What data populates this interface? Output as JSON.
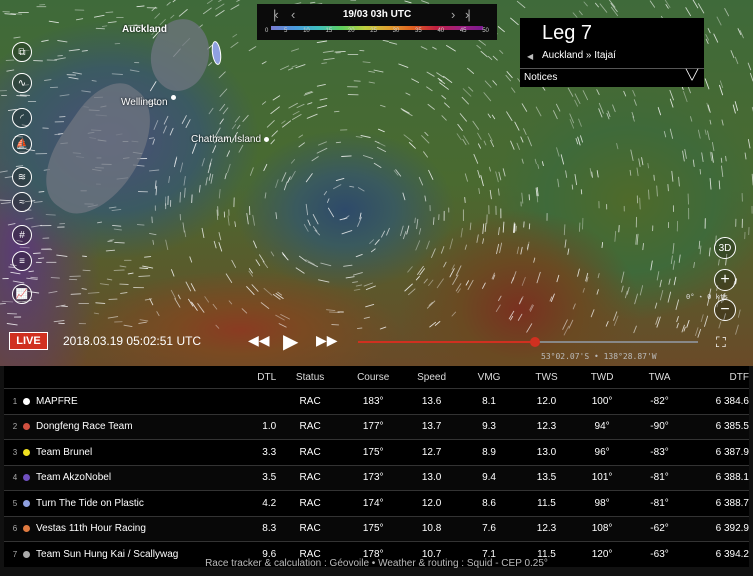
{
  "topbar": {
    "datetime": "19/03 03h UTC",
    "scale_ticks": [
      "0",
      "5",
      "10",
      "15",
      "20",
      "25",
      "30",
      "35",
      "40",
      "45",
      "50"
    ]
  },
  "map": {
    "places": [
      "Auckland",
      "Wellington",
      "Chatham Island"
    ]
  },
  "leg": {
    "title": "Leg 7",
    "route": "Auckland » Itajaí",
    "notices_label": "Notices"
  },
  "controls": {
    "view3d_label": "3D",
    "zoom_in": "+",
    "zoom_out": "−"
  },
  "compass": {
    "text": "0° ⋆ 0 kts"
  },
  "playback": {
    "live_label": "LIVE",
    "time": "2018.03.19 05:02:51 UTC",
    "progress": 0.52,
    "coordinates": "53°02.07'S • 138°28.87'W"
  },
  "table": {
    "headers": [
      "DTL",
      "Status",
      "Course",
      "Speed",
      "VMG",
      "TWS",
      "TWD",
      "TWA",
      "DTF"
    ],
    "rows": [
      {
        "rank": "1",
        "color": "#ffffff",
        "name": "MAPFRE",
        "dtl": "",
        "status": "RAC",
        "course": "183°",
        "speed": "13.6",
        "vmg": "8.1",
        "tws": "12.0",
        "twd": "100°",
        "twa": "-82°",
        "dtf": "6 384.6"
      },
      {
        "rank": "2",
        "color": "#d05040",
        "name": "Dongfeng Race Team",
        "dtl": "1.0",
        "status": "RAC",
        "course": "177°",
        "speed": "13.7",
        "vmg": "9.3",
        "tws": "12.3",
        "twd": "94°",
        "twa": "-90°",
        "dtf": "6 385.5"
      },
      {
        "rank": "3",
        "color": "#f0e020",
        "name": "Team Brunel",
        "dtl": "3.3",
        "status": "RAC",
        "course": "175°",
        "speed": "12.7",
        "vmg": "8.9",
        "tws": "13.0",
        "twd": "96°",
        "twa": "-83°",
        "dtf": "6 387.9"
      },
      {
        "rank": "4",
        "color": "#7050c0",
        "name": "Team AkzoNobel",
        "dtl": "3.5",
        "status": "RAC",
        "course": "173°",
        "speed": "13.0",
        "vmg": "9.4",
        "tws": "13.5",
        "twd": "101°",
        "twa": "-81°",
        "dtf": "6 388.1"
      },
      {
        "rank": "5",
        "color": "#8fa0e0",
        "name": "Turn The Tide on Plastic",
        "dtl": "4.2",
        "status": "RAC",
        "course": "174°",
        "speed": "12.0",
        "vmg": "8.6",
        "tws": "11.5",
        "twd": "98°",
        "twa": "-81°",
        "dtf": "6 388.7"
      },
      {
        "rank": "6",
        "color": "#e07a40",
        "name": "Vestas 11th Hour Racing",
        "dtl": "8.3",
        "status": "RAC",
        "course": "175°",
        "speed": "10.8",
        "vmg": "7.6",
        "tws": "12.3",
        "twd": "108°",
        "twa": "-62°",
        "dtf": "6 392.9"
      },
      {
        "rank": "7",
        "color": "#aaaaaa",
        "name": "Team Sun Hung Kai / Scallywag",
        "dtl": "9.6",
        "status": "RAC",
        "course": "178°",
        "speed": "10.7",
        "vmg": "7.1",
        "tws": "11.5",
        "twd": "120°",
        "twa": "-63°",
        "dtf": "6 394.2"
      }
    ]
  },
  "footer": "Race tracker & calculation : Géovoile • Weather & routing : Squid - CEP 0.25°"
}
